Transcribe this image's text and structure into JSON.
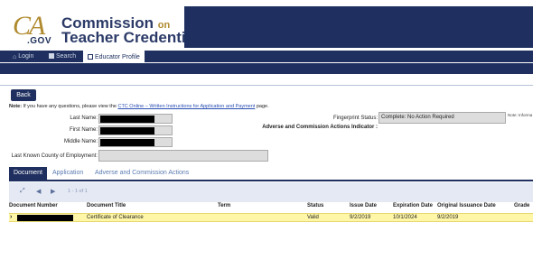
{
  "header": {
    "logo_ca": "CA",
    "logo_gov": ".GOV",
    "title_line1": "Commission",
    "title_on": "on",
    "title_line2": "Teacher Credentialing"
  },
  "nav": {
    "items": [
      {
        "label": "Login",
        "icon": "home-icon"
      },
      {
        "label": "Search",
        "icon": "search-icon"
      },
      {
        "label": "Educator Profile",
        "icon": "profile-icon"
      }
    ],
    "active_index": 2
  },
  "page": {
    "back_label": "Back",
    "note_prefix": "Note:",
    "note_text": " If you have any questions, please view the ",
    "note_link": "CTC Online – Written Instructions for Application and Payment",
    "note_suffix": " page.",
    "note_right": "Note: Informa"
  },
  "profile": {
    "last_name_label": "Last Name:",
    "first_name_label": "First Name:",
    "middle_name_label": "Middle Name:",
    "county_label": "Last Known County of Employment:",
    "county_value": "",
    "fingerprint_label": "Fingerprint Status:",
    "fingerprint_value": "Complete: No Action Required",
    "adverse_label": "Adverse and Commission Actions Indicator :"
  },
  "tabs": [
    {
      "label": "Document",
      "active": true
    },
    {
      "label": "Application",
      "active": false
    },
    {
      "label": "Adverse and Commission Actions",
      "active": false
    }
  ],
  "toolbar": {
    "pager_text": "1 - 1 of 1"
  },
  "table": {
    "columns": [
      "Document Number",
      "Document Title",
      "Term",
      "Status",
      "Issue Date",
      "Expiration Date",
      "Original Issuance Date",
      "Grade"
    ],
    "rows": [
      {
        "document_number": "",
        "document_title": "Certificate of Clearance",
        "term": "",
        "status": "Valid",
        "issue_date": "9/2/2019",
        "expiration_date": "10/1/2024",
        "original_issuance_date": "9/2/2019",
        "grade": ""
      }
    ]
  },
  "colors": {
    "navy": "#1f3060",
    "gold": "#b08a2e",
    "row_highlight": "#fff6a8",
    "link": "#2a4fb3"
  }
}
